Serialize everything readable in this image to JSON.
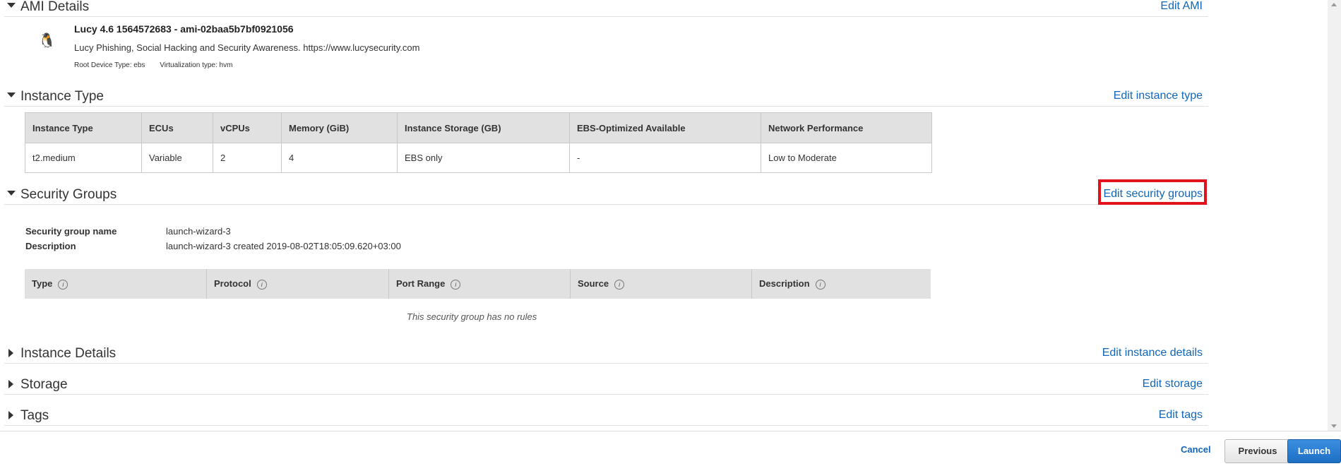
{
  "ami": {
    "section_title": "AMI Details",
    "edit_label": "Edit AMI",
    "icon": "linux-penguin-icon",
    "name": "Lucy 4.6 1564572683 - ami-02baa5b7bf0921056",
    "description": "Lucy Phishing, Social Hacking and Security Awareness. https://www.lucysecurity.com",
    "root_device": "Root Device Type: ebs",
    "virtualization": "Virtualization type: hvm"
  },
  "instance_type": {
    "section_title": "Instance Type",
    "edit_label": "Edit instance type",
    "columns": [
      "Instance Type",
      "ECUs",
      "vCPUs",
      "Memory (GiB)",
      "Instance Storage (GB)",
      "EBS-Optimized Available",
      "Network Performance"
    ],
    "row": [
      "t2.medium",
      "Variable",
      "2",
      "4",
      "EBS only",
      "-",
      "Low to Moderate"
    ]
  },
  "security_groups": {
    "section_title": "Security Groups",
    "edit_label": "Edit security groups",
    "name_label": "Security group name",
    "name_value": "launch-wizard-3",
    "desc_label": "Description",
    "desc_value": "launch-wizard-3 created 2019-08-02T18:05:09.620+03:00",
    "rule_columns": [
      "Type",
      "Protocol",
      "Port Range",
      "Source",
      "Description"
    ],
    "empty_message": "This security group has no rules"
  },
  "instance_details": {
    "section_title": "Instance Details",
    "edit_label": "Edit instance details"
  },
  "storage": {
    "section_title": "Storage",
    "edit_label": "Edit storage"
  },
  "tags": {
    "section_title": "Tags",
    "edit_label": "Edit tags"
  },
  "footer": {
    "cancel": "Cancel",
    "previous": "Previous",
    "launch": "Launch"
  },
  "colors": {
    "link": "#1166bb",
    "highlight": "#e0121b",
    "primary_button": "#1d6fc4"
  }
}
